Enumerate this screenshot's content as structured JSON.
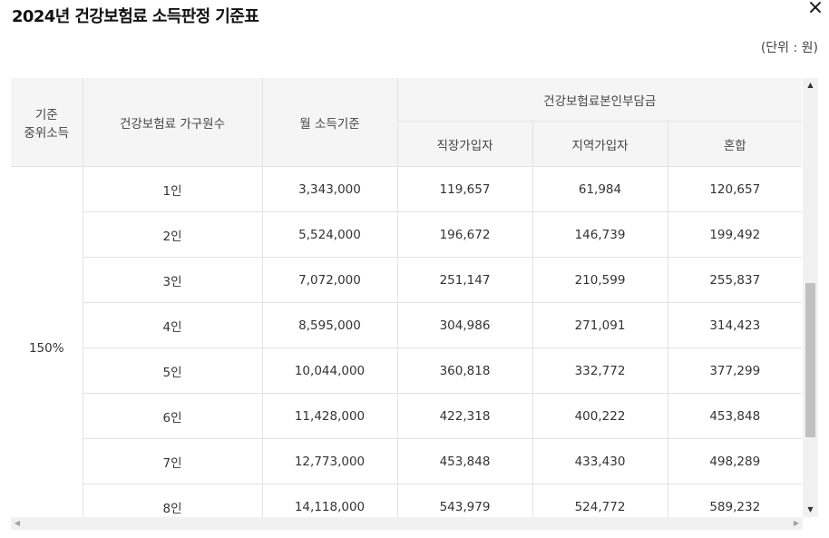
{
  "title": "2024년 건강보험료 소득판정 기준표",
  "close_icon": "×",
  "unit_label": "(단위 : 원)",
  "table": {
    "headers": {
      "median_income": "기준\n중위소득",
      "household_size": "건강보험료 가구원수",
      "monthly_income": "월 소득기준",
      "premium_group": "건강보험료본인부담금",
      "employee": "직장가입자",
      "regional": "지역가입자",
      "mixed": "혼합"
    },
    "median_percent": "150%",
    "rows": [
      {
        "size": "1인",
        "income": "3,343,000",
        "employee": "119,657",
        "regional": "61,984",
        "mixed": "120,657"
      },
      {
        "size": "2인",
        "income": "5,524,000",
        "employee": "196,672",
        "regional": "146,739",
        "mixed": "199,492"
      },
      {
        "size": "3인",
        "income": "7,072,000",
        "employee": "251,147",
        "regional": "210,599",
        "mixed": "255,837"
      },
      {
        "size": "4인",
        "income": "8,595,000",
        "employee": "304,986",
        "regional": "271,091",
        "mixed": "314,423"
      },
      {
        "size": "5인",
        "income": "10,044,000",
        "employee": "360,818",
        "regional": "332,772",
        "mixed": "377,299"
      },
      {
        "size": "6인",
        "income": "11,428,000",
        "employee": "422,318",
        "regional": "400,222",
        "mixed": "453,848"
      },
      {
        "size": "7인",
        "income": "12,773,000",
        "employee": "453,848",
        "regional": "433,430",
        "mixed": "498,289"
      },
      {
        "size": "8인",
        "income": "14,118,000",
        "employee": "543,979",
        "regional": "524,772",
        "mixed": "589,232"
      }
    ]
  },
  "scrollbar": {
    "up": "▲",
    "down": "▼",
    "left": "◀",
    "right": "▶"
  }
}
